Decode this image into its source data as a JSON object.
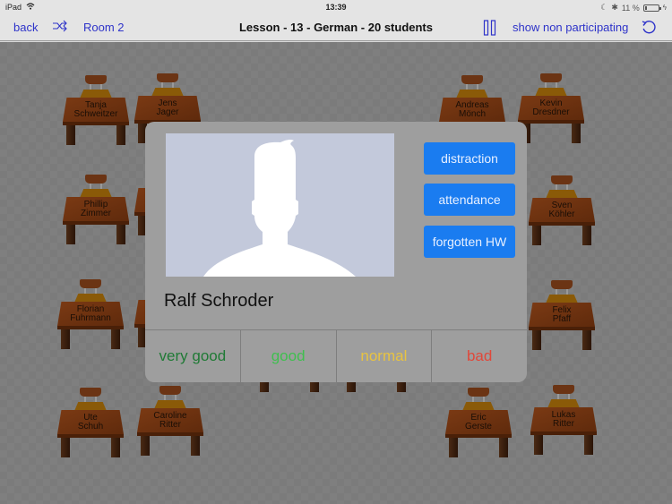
{
  "status_bar": {
    "device": "iPad",
    "time": "13:39",
    "battery_text": "11 %",
    "battery_level": 0.11
  },
  "nav": {
    "back_label": "back",
    "room_label": "Room 2",
    "title": "Lesson - 13 - German - 20 students",
    "show_non_participating_label": "show non participating",
    "link_color": "#2e33c9"
  },
  "desks": [
    {
      "first": "Tanja",
      "last": "Schweitzer"
    },
    {
      "first": "Jens",
      "last": "Jager"
    },
    {
      "first": "Andreas",
      "last": "Mönch"
    },
    {
      "first": "Kevin",
      "last": "Dresdner"
    },
    {
      "first": "Phillip",
      "last": "Zimmer"
    },
    {
      "first": "Sven",
      "last": "Köhler"
    },
    {
      "first": "Florian",
      "last": "Fuhrmann"
    },
    {
      "first": "Felix",
      "last": "Pfaff"
    },
    {
      "first": "Ute",
      "last": "Schuh"
    },
    {
      "first": "Caroline",
      "last": "Ritter"
    },
    {
      "first": "Eric",
      "last": "Gerste"
    },
    {
      "first": "Lukas",
      "last": "Ritter"
    }
  ],
  "modal": {
    "student_name": "Ralf Schroder",
    "photo_icon": "person-silhouette-icon",
    "actions": [
      {
        "label": "distraction"
      },
      {
        "label": "attendance"
      },
      {
        "label": "forgotten HW"
      }
    ],
    "action_color": "#1a7cf0",
    "ratings": [
      {
        "label": "very good",
        "color": "#1f7a35"
      },
      {
        "label": "good",
        "color": "#3fbf4f"
      },
      {
        "label": "normal",
        "color": "#e8c341"
      },
      {
        "label": "bad",
        "color": "#e0483a"
      }
    ]
  }
}
